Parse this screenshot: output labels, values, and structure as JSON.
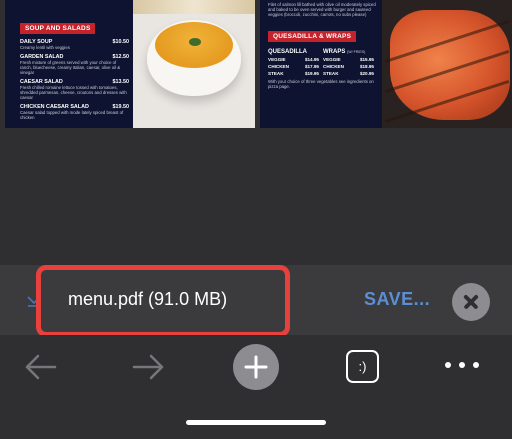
{
  "pdf_preview": {
    "left_page": {
      "category": "SOUP AND SALADS",
      "items": [
        {
          "name": "DAILY SOUP",
          "price": "$10.50",
          "desc": "Creamy lentil with veggies"
        },
        {
          "name": "GARDEN SALAD",
          "price": "$12.50",
          "desc": "Fresh mixture of greens served with your choice of ranch, bluecheese, creamy Italian, caesar, olive oil & vinegar"
        },
        {
          "name": "CAESAR SALAD",
          "price": "$13.50",
          "desc": "Fresh chilled romaine lettuce tossed with tomatoes, shredded parmesan, cheese, croutons and dresses with caesar"
        },
        {
          "name": "CHICKEN CAESAR SALAD",
          "price": "$19.50",
          "desc": "Caesar salad topped with mode lately spiced breast of chicken"
        }
      ]
    },
    "right_page": {
      "top_desc": "Filet of salmon lill bathed with olive oil moderately spiced and baked to be oven served with burger and sauteed veggies (broccoli, zucchini, carrots, no subs please)",
      "category": "QUESADILLA & WRAPS",
      "quesadilla_title": "QUESADILLA",
      "quesadilla": [
        {
          "name": "VEGGIE",
          "price": "$14.95"
        },
        {
          "name": "CHICKEN",
          "price": "$17.95"
        },
        {
          "name": "STEAK",
          "price": "$19.95"
        }
      ],
      "wraps_title": "WRAPS",
      "wraps_note": "(W/ FRIES)",
      "wraps": [
        {
          "name": "VEGGIE",
          "price": "$15.95"
        },
        {
          "name": "CHICKEN",
          "price": "$18.95"
        },
        {
          "name": "STEAK",
          "price": "$20.95"
        }
      ],
      "footer_note": "With your choice of three vegetables see ingredients on pizza page."
    }
  },
  "download": {
    "file_name": "menu.pdf (91.0 MB)",
    "save_label": "SAVE..."
  },
  "toolbar": {
    "tabs_glyph": ":)"
  }
}
